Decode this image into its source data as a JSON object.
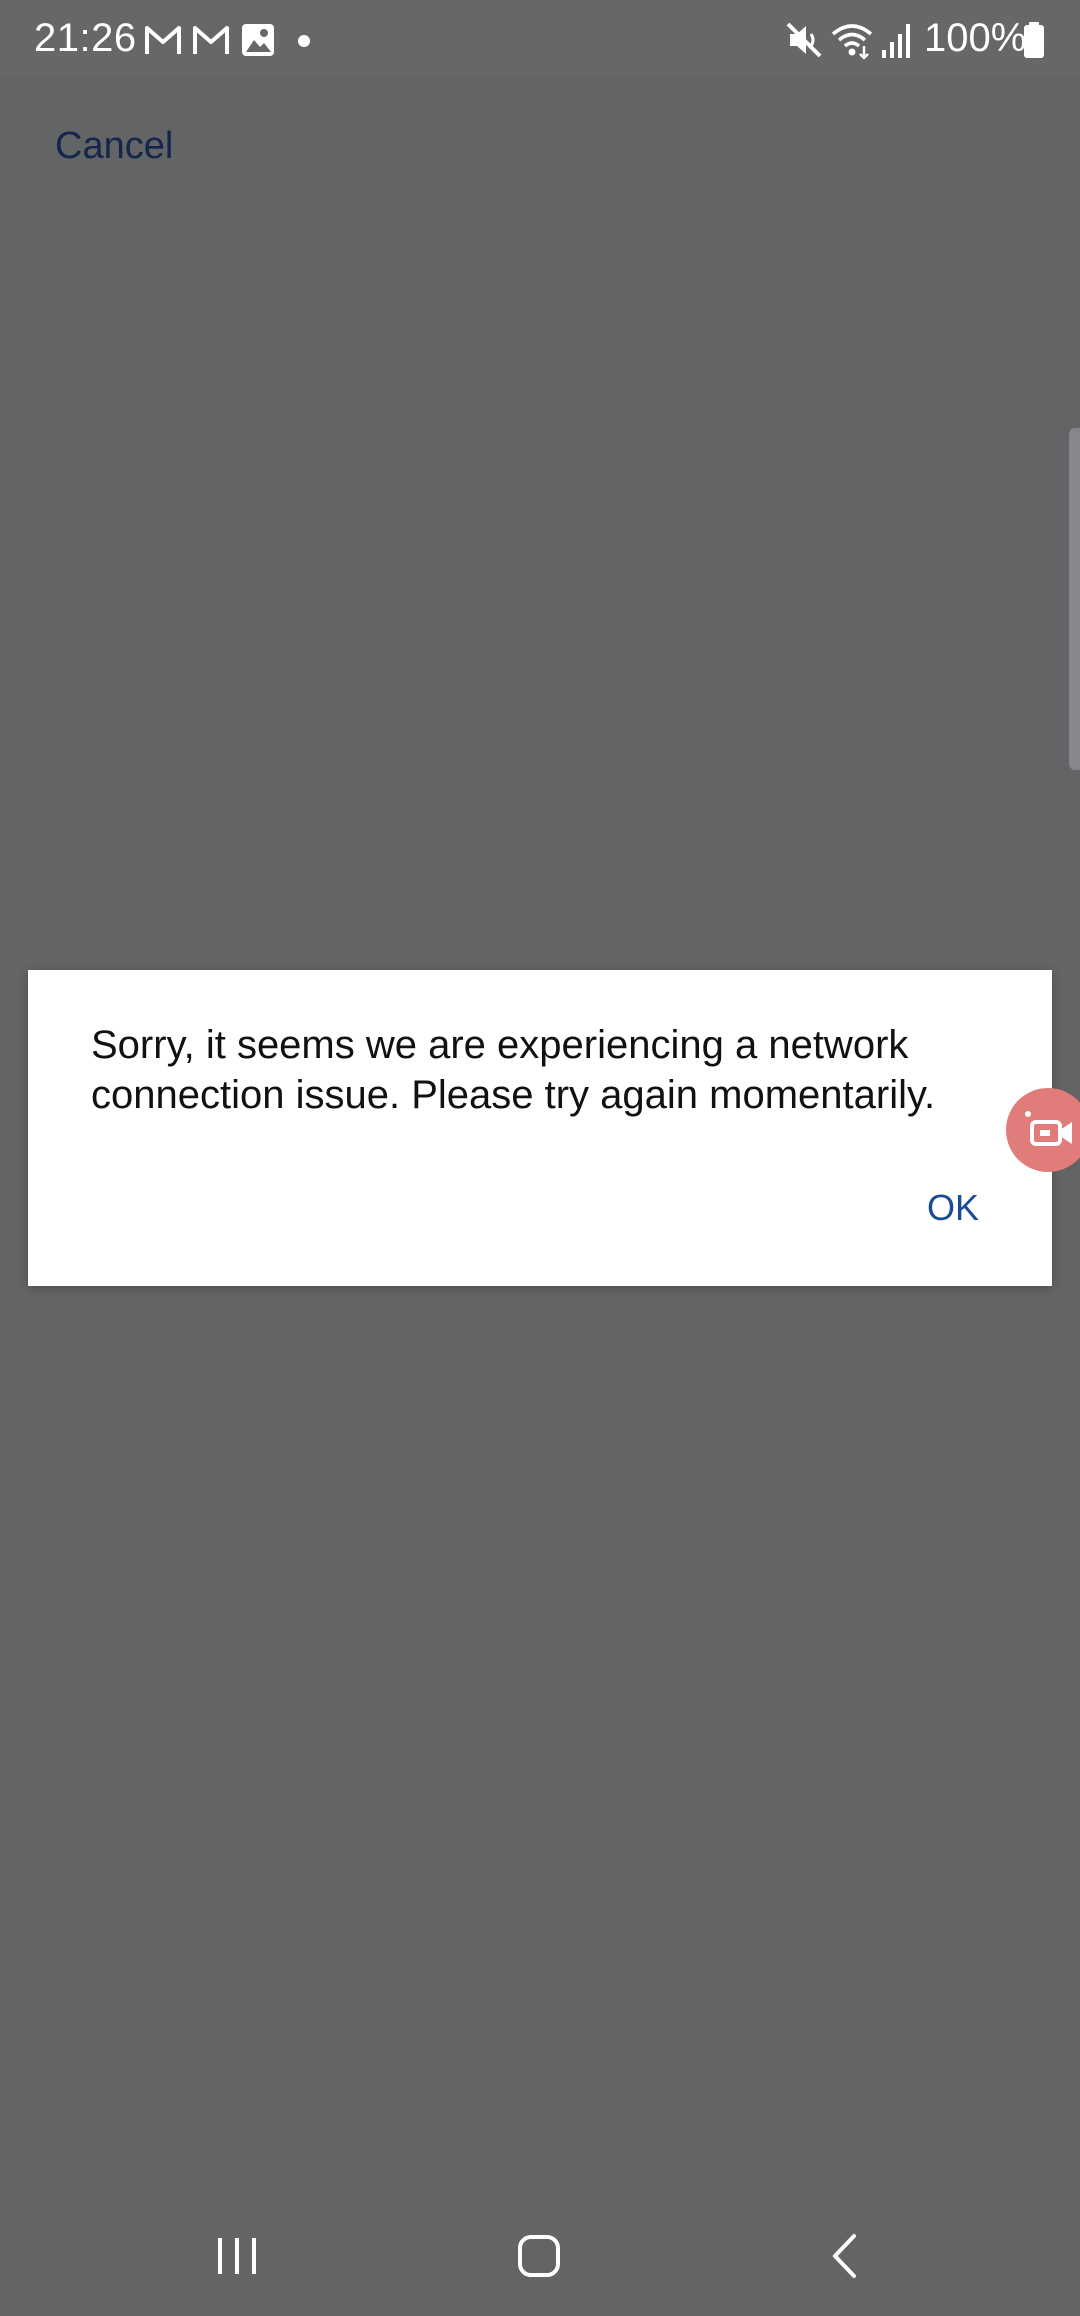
{
  "status_bar": {
    "time": "21:26",
    "battery": "100%",
    "icons": [
      "gmail-icon",
      "gmail-icon",
      "gallery-icon",
      "dot-icon",
      "mute-icon",
      "wifi-icon",
      "signal-icon",
      "battery-icon"
    ]
  },
  "header": {
    "cancel_label": "Cancel"
  },
  "dialog": {
    "message": "Sorry, it seems we are experiencing a network connection issue. Please try again momentarily.",
    "ok_label": "OK"
  },
  "colors": {
    "scrim": "#636466",
    "dialog_bg": "#ffffff",
    "link": "#1a4b96",
    "cancel": "#14264a",
    "fab": "#e07d7a"
  },
  "nav_bar": {
    "buttons": [
      "recent-apps",
      "home",
      "back"
    ]
  }
}
